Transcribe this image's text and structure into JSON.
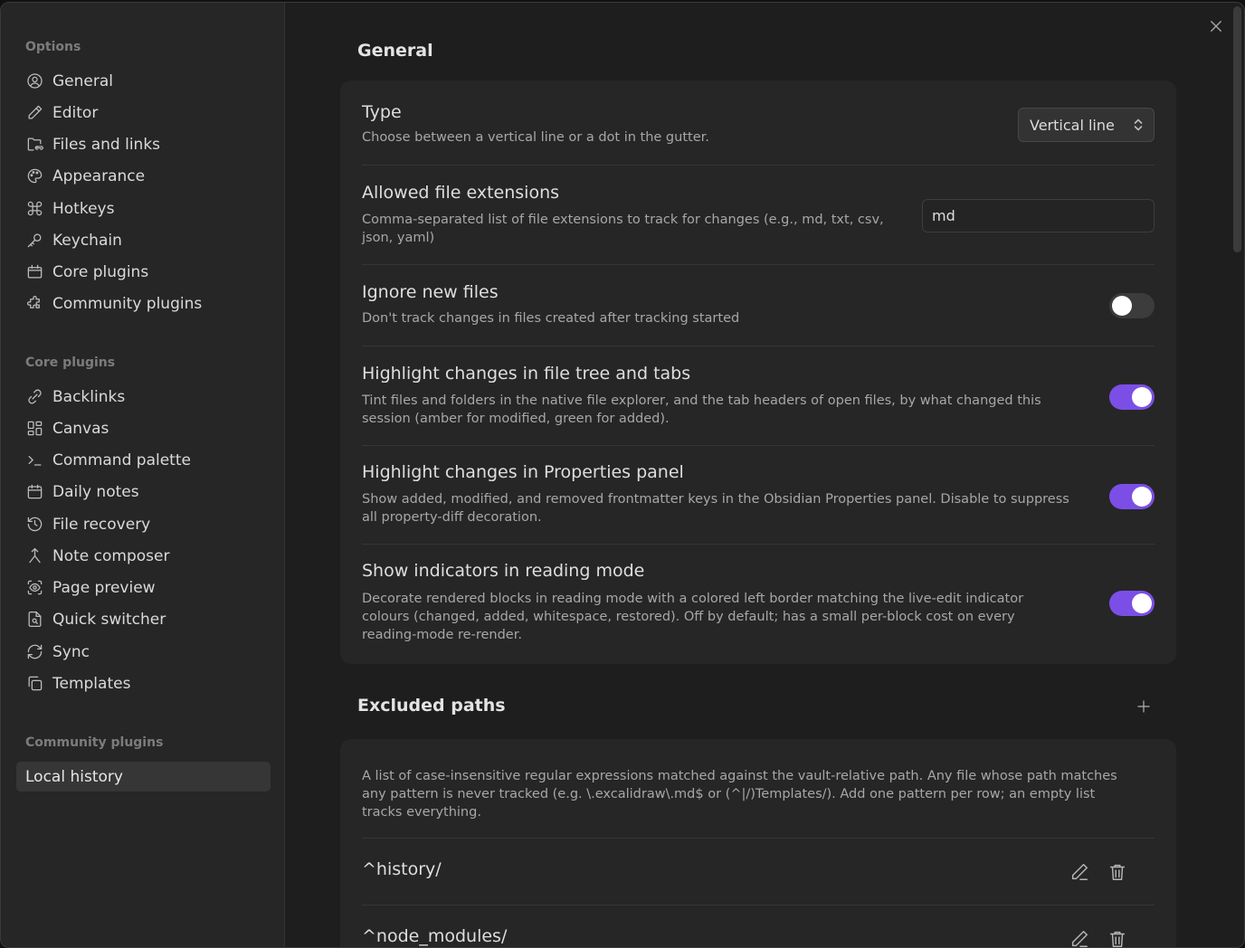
{
  "sidebar": {
    "options_heading": "Options",
    "options": [
      {
        "label": "General",
        "icon": "user-circle-icon"
      },
      {
        "label": "Editor",
        "icon": "pencil-icon"
      },
      {
        "label": "Files and links",
        "icon": "folder-link-icon"
      },
      {
        "label": "Appearance",
        "icon": "palette-icon"
      },
      {
        "label": "Hotkeys",
        "icon": "command-icon"
      },
      {
        "label": "Keychain",
        "icon": "key-icon"
      },
      {
        "label": "Core plugins",
        "icon": "calendar-box-icon"
      },
      {
        "label": "Community plugins",
        "icon": "puzzle-icon"
      }
    ],
    "core_heading": "Core plugins",
    "core": [
      {
        "label": "Backlinks",
        "icon": "backlink-icon"
      },
      {
        "label": "Canvas",
        "icon": "layout-grid-icon"
      },
      {
        "label": "Command palette",
        "icon": "terminal-icon"
      },
      {
        "label": "Daily notes",
        "icon": "calendar-icon"
      },
      {
        "label": "File recovery",
        "icon": "history-icon"
      },
      {
        "label": "Note composer",
        "icon": "merge-icon"
      },
      {
        "label": "Page preview",
        "icon": "eye-scan-icon"
      },
      {
        "label": "Quick switcher",
        "icon": "file-search-icon"
      },
      {
        "label": "Sync",
        "icon": "refresh-icon"
      },
      {
        "label": "Templates",
        "icon": "copy-icon"
      }
    ],
    "community_heading": "Community plugins",
    "community": [
      {
        "label": "Local history"
      }
    ]
  },
  "general": {
    "title": "General",
    "type": {
      "name": "Type",
      "desc": "Choose between a vertical line or a dot in the gutter.",
      "value": "Vertical line"
    },
    "extensions": {
      "name": "Allowed file extensions",
      "desc": "Comma-separated list of file extensions to track for changes (e.g., md, txt, csv, json, yaml)",
      "value": "md"
    },
    "ignore_new": {
      "name": "Ignore new files",
      "desc": "Don't track changes in files created after tracking started",
      "enabled": false
    },
    "highlight_tree": {
      "name": "Highlight changes in file tree and tabs",
      "desc": "Tint files and folders in the native file explorer, and the tab headers of open files, by what changed this session (amber for modified, green for added).",
      "enabled": true
    },
    "highlight_props": {
      "name": "Highlight changes in Properties panel",
      "desc": "Show added, modified, and removed frontmatter keys in the Obsidian Properties panel. Disable to suppress all property-diff decoration.",
      "enabled": true
    },
    "reading_mode": {
      "name": "Show indicators in reading mode",
      "desc": "Decorate rendered blocks in reading mode with a colored left border matching the live-edit indicator colours (changed, added, whitespace, restored). Off by default; has a small per-block cost on every reading-mode re-render.",
      "enabled": true
    }
  },
  "excluded": {
    "title": "Excluded paths",
    "desc": "A list of case-insensitive regular expressions matched against the vault-relative path. Any file whose path matches any pattern is never tracked (e.g. \\.excalidraw\\.md$ or (^|/)Templates/). Add one pattern per row; an empty list tracks everything.",
    "paths": [
      "^history/",
      "^node_modules/"
    ]
  },
  "colors": {
    "accent": "#7b4fe6",
    "background": "#1e1e1e",
    "card": "#262626"
  }
}
